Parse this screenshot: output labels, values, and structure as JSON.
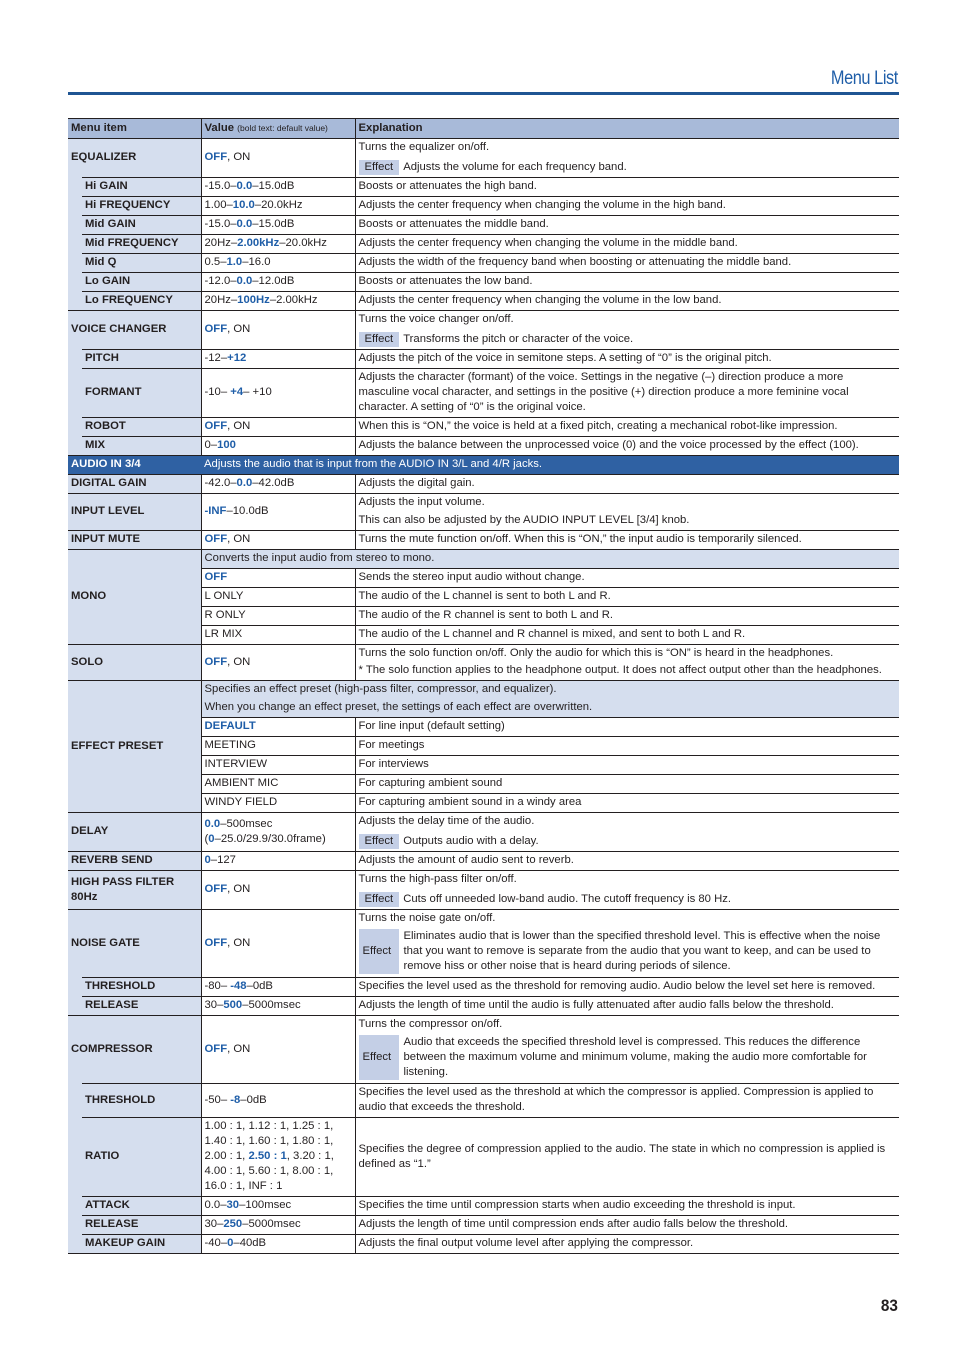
{
  "header": {
    "title": "Menu List"
  },
  "page_number": "83",
  "table": {
    "columns": {
      "item": "Menu item",
      "value": "Value",
      "value_note": "(bold text: default value)",
      "explanation": "Explanation"
    },
    "effect_label": "Effect",
    "equalizer": {
      "label": "EQUALIZER",
      "value_default": "OFF",
      "value_rest": ", ON",
      "explanation": "Turns the equalizer on/off.",
      "effect": "Adjusts the volume for each frequency band.",
      "rows": [
        {
          "label": "Hi GAIN",
          "pre": "-15.0–",
          "def": "0.0",
          "post": "–15.0dB",
          "explanation": "Boosts or attenuates the high band."
        },
        {
          "label": "Hi FREQUENCY",
          "pre": "1.00–",
          "def": "10.0",
          "post": "–20.0kHz",
          "explanation": "Adjusts the center frequency when changing the volume in the high band."
        },
        {
          "label": "Mid GAIN",
          "pre": "-15.0–",
          "def": "0.0",
          "post": "–15.0dB",
          "explanation": "Boosts or attenuates the middle band."
        },
        {
          "label": "Mid FREQUENCY",
          "pre": "20Hz–",
          "def": "2.00kHz",
          "post": "–20.0kHz",
          "explanation": "Adjusts the center frequency when changing the volume in the middle band."
        },
        {
          "label": "Mid Q",
          "pre": "0.5–",
          "def": "1.0",
          "post": "–16.0",
          "explanation": "Adjusts the width of the frequency band when boosting or attenuating the middle band."
        },
        {
          "label": "Lo GAIN",
          "pre": "-12.0–",
          "def": "0.0",
          "post": "–12.0dB",
          "explanation": "Boosts or attenuates the low band."
        },
        {
          "label": "Lo FREQUENCY",
          "pre": "20Hz–",
          "def": "100Hz",
          "post": "–2.00kHz",
          "explanation": "Adjusts the center frequency when changing the volume in the low band."
        }
      ]
    },
    "voice_changer": {
      "label": "VOICE CHANGER",
      "value_default": "OFF",
      "value_rest": ", ON",
      "explanation": "Turns the voice changer on/off.",
      "effect": "Transforms the pitch or character of the voice.",
      "rows": [
        {
          "label": "PITCH",
          "pre": "-12–",
          "def": "+12",
          "post": "",
          "explanation": "Adjusts the pitch of the voice in semitone steps. A setting of “0” is the original pitch."
        },
        {
          "label": "FORMANT",
          "pre": "-10– ",
          "def": "+4",
          "post": "– +10",
          "explanation": "Adjusts the character (formant) of the voice. Settings in the negative (–) direction produce a more masculine vocal character, and settings in the positive (+) direction produce a more feminine vocal character. A setting of “0” is the original voice."
        },
        {
          "label": "ROBOT",
          "pre": "",
          "def": "OFF",
          "post": ", ON",
          "explanation": "When this is “ON,” the voice is held at a fixed pitch, creating a mechanical robot-like impression."
        },
        {
          "label": "MIX",
          "pre": "0–",
          "def": "100",
          "post": "",
          "explanation": "Adjusts the balance between the unprocessed voice (0) and the voice processed by the effect (100)."
        }
      ]
    },
    "audio_in": {
      "label": "AUDIO IN 3/4",
      "explanation": "Adjusts the audio that is input from the AUDIO IN 3/L and 4/R jacks."
    },
    "digital_gain": {
      "label": "DIGITAL GAIN",
      "pre": "-42.0–",
      "def": "0.0",
      "post": "–42.0dB",
      "explanation": "Adjusts the digital gain."
    },
    "input_level": {
      "label": "INPUT LEVEL",
      "pre": "",
      "def": "-INF",
      "post": "–10.0dB",
      "explanation": "Adjusts the input volume.",
      "explanation2": "This can also be adjusted by the AUDIO INPUT LEVEL [3/4] knob."
    },
    "input_mute": {
      "label": "INPUT MUTE",
      "pre": "",
      "def": "OFF",
      "post": ", ON",
      "explanation": "Turns the mute function on/off. When this is “ON,” the input audio is temporarily silenced."
    },
    "mono": {
      "label": "MONO",
      "intro": "Converts the input audio from stereo to mono.",
      "options": [
        {
          "value": "OFF",
          "default": true,
          "explanation": "Sends the stereo input audio without change."
        },
        {
          "value": "L ONLY",
          "default": false,
          "explanation": "The audio of the L channel is sent to both L and R."
        },
        {
          "value": "R ONLY",
          "default": false,
          "explanation": "The audio of the R channel is sent to both L and R."
        },
        {
          "value": "LR MIX",
          "default": false,
          "explanation": "The audio of the L channel and R channel is mixed, and sent to both L and R."
        }
      ]
    },
    "solo": {
      "label": "SOLO",
      "pre": "",
      "def": "OFF",
      "post": ", ON",
      "explanation": "Turns the solo function on/off. Only the audio for which this is “ON” is heard in the headphones.",
      "note": "* The solo function applies to the headphone output. It does not affect output other than the headphones."
    },
    "effect_preset": {
      "label": "EFFECT PRESET",
      "intro1": "Specifies an effect preset (high-pass filter, compressor, and equalizer).",
      "intro2": "When you change an effect preset, the settings of each effect are overwritten.",
      "options": [
        {
          "value": "DEFAULT",
          "default": true,
          "explanation": "For line input (default setting)"
        },
        {
          "value": "MEETING",
          "default": false,
          "explanation": "For meetings"
        },
        {
          "value": "INTERVIEW",
          "default": false,
          "explanation": "For interviews"
        },
        {
          "value": "AMBIENT MIC",
          "default": false,
          "explanation": "For capturing ambient sound"
        },
        {
          "value": "WINDY FIELD",
          "default": false,
          "explanation": "For capturing ambient sound in a windy area"
        }
      ]
    },
    "delay": {
      "label": "DELAY",
      "def1": "0.0",
      "post1": "–500msec",
      "pre2": "(",
      "def2": "0",
      "post2": "–25.0/29.9/30.0frame)",
      "explanation": "Adjusts the delay time of the audio.",
      "effect": "Outputs audio with a delay."
    },
    "reverb_send": {
      "label": "REVERB SEND",
      "pre": "",
      "def": "0",
      "post": "–127",
      "explanation": "Adjusts the amount of audio sent to reverb."
    },
    "hpf": {
      "label": "HIGH PASS FILTER 80Hz",
      "def": "OFF",
      "post": ", ON",
      "explanation": "Turns the high-pass filter on/off.",
      "effect": "Cuts off unneeded low-band audio. The cutoff frequency is 80 Hz."
    },
    "noise_gate": {
      "label": "NOISE GATE",
      "def": "OFF",
      "post": ", ON",
      "explanation": "Turns the noise gate on/off.",
      "effect": "Eliminates audio that is lower than the specified threshold level. This is effective when the noise that you want to remove is separate from the audio that you want to keep, and can be used to remove hiss or other noise that is heard during periods of silence.",
      "rows": [
        {
          "label": "THRESHOLD",
          "pre": "-80– ",
          "def": "-48",
          "post": "–0dB",
          "explanation": "Specifies the level used as the threshold for removing audio. Audio below the level set here is removed."
        },
        {
          "label": "RELEASE",
          "pre": "30–",
          "def": "500",
          "post": "–5000msec",
          "explanation": "Adjusts the length of time until the audio is fully attenuated after audio falls below the threshold."
        }
      ]
    },
    "compressor": {
      "label": "COMPRESSOR",
      "def": "OFF",
      "post": ", ON",
      "explanation": "Turns the compressor on/off.",
      "effect": "Audio that exceeds the specified threshold level is compressed. This reduces the difference between the maximum volume and minimum volume, making the audio more comfortable for listening.",
      "threshold": {
        "label": "THRESHOLD",
        "pre": "-50– ",
        "def": "-8",
        "post": "–0dB",
        "explanation": "Specifies the level used as the threshold at which the compressor is applied. Compression is applied to audio that exceeds the threshold."
      },
      "ratio": {
        "label": "RATIO",
        "pre": "1.00 : 1, 1.12 : 1, 1.25 : 1, 1.40 : 1, 1.60 : 1, 1.80 : 1, 2.00 : 1, ",
        "def": "2.50 : 1",
        "post": ", 3.20 : 1, 4.00 : 1, 5.60 : 1, 8.00 : 1, 16.0 : 1, INF : 1",
        "explanation": "Specifies the degree of compression applied to the audio. The state in which no compression is applied is defined as “1.”"
      },
      "rows": [
        {
          "label": "ATTACK",
          "pre": "0.0–",
          "def": "30",
          "post": "–100msec",
          "explanation": "Specifies the time until compression starts when audio exceeding the threshold is input."
        },
        {
          "label": "RELEASE",
          "pre": "30–",
          "def": "250",
          "post": "–5000msec",
          "explanation": "Adjusts the length of time until compression ends after audio falls below the threshold."
        },
        {
          "label": "MAKEUP GAIN",
          "pre": "-40–",
          "def": "0",
          "post": "–40dB",
          "explanation": "Adjusts the final output volume level after applying the compressor."
        }
      ]
    }
  }
}
